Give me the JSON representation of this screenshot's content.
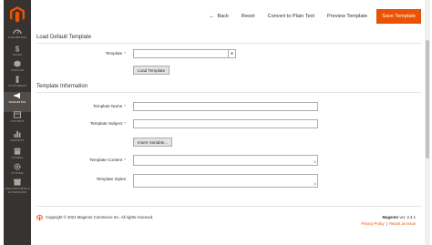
{
  "sidebar": {
    "items": [
      {
        "label": "DASHBOARD",
        "icon": "dashboard-icon"
      },
      {
        "label": "SALES",
        "icon": "dollar-icon"
      },
      {
        "label": "CATALOG",
        "icon": "cube-icon"
      },
      {
        "label": "CUSTOMERS",
        "icon": "person-icon"
      },
      {
        "label": "MARKETING",
        "icon": "megaphone-icon",
        "active": true
      },
      {
        "label": "CONTENT",
        "icon": "layout-icon"
      },
      {
        "label": "REPORTS",
        "icon": "bar-chart-icon"
      },
      {
        "label": "STORES",
        "icon": "store-icon"
      },
      {
        "label": "SYSTEM",
        "icon": "gear-icon"
      },
      {
        "label": "FIND PARTNERS & EXTENSIONS",
        "icon": "box-icon"
      }
    ]
  },
  "toolbar": {
    "back": "Back",
    "reset": "Reset",
    "convert": "Convert to Plain Text",
    "preview": "Preview Template",
    "save": "Save Template"
  },
  "load_default": {
    "title": "Load Default Template",
    "template_label": "Template",
    "template_value": "",
    "load_button": "Load Template"
  },
  "template_info": {
    "title": "Template Information",
    "name_label": "Template Name",
    "subject_label": "Template Subject",
    "insert_variable_button": "Insert Variable...",
    "content_label": "Template Content",
    "styles_label": "Template Styles",
    "required_marker": "*"
  },
  "footer": {
    "copyright": "Copyright © 2021 Magento Commerce Inc. All rights reserved.",
    "brand": "Magento",
    "version": " ver. 2.4.1",
    "privacy": "Privacy Policy",
    "separator": "|",
    "report": "Report an Issue"
  },
  "colors": {
    "accent": "#eb5202",
    "sidebar": "#373330",
    "required": "#e22626"
  }
}
